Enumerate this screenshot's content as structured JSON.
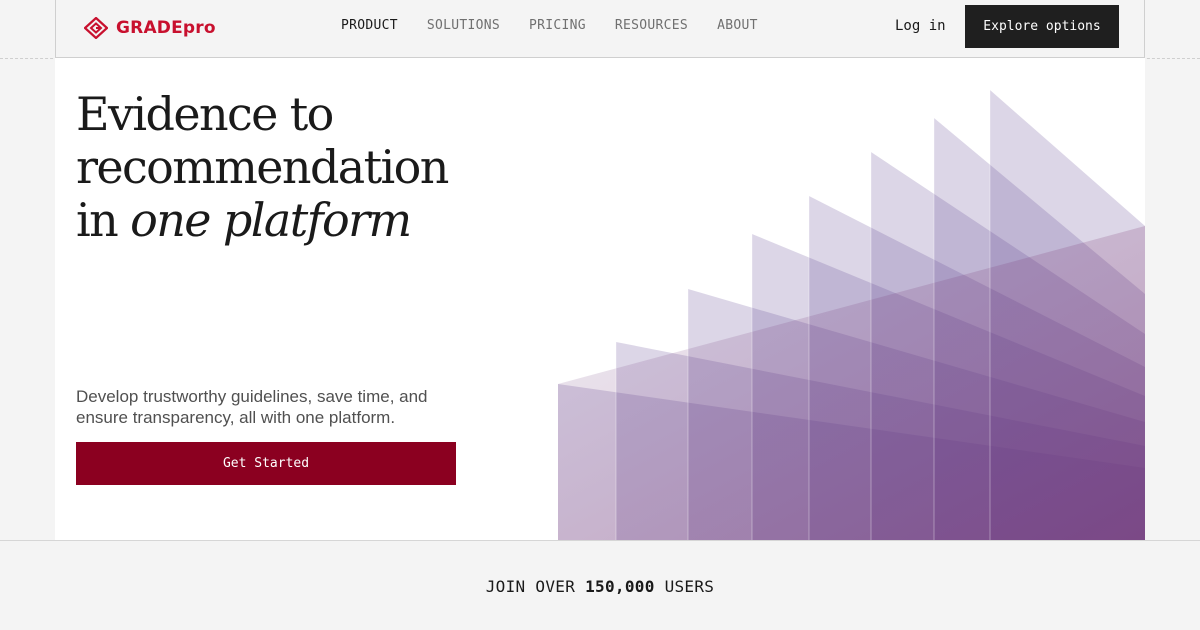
{
  "brand": {
    "name": "GRADEpro",
    "accent_color": "#c8102e",
    "logo_icon": "diamond-logo-icon"
  },
  "nav": {
    "items": [
      {
        "label": "PRODUCT",
        "active": true
      },
      {
        "label": "SOLUTIONS",
        "active": false
      },
      {
        "label": "PRICING",
        "active": false
      },
      {
        "label": "RESOURCES",
        "active": false
      },
      {
        "label": "ABOUT",
        "active": false
      }
    ],
    "login_label": "Log in",
    "explore_label": "Explore options"
  },
  "hero": {
    "headline_line1": "Evidence to",
    "headline_line2": "recommendation",
    "headline_line3_prefix": "in ",
    "headline_line3_emphasis": "one platform",
    "subtext": "Develop trustworthy guidelines, save time, and ensure transparency, all with one platform.",
    "cta_label": "Get Started",
    "cta_color": "#8b0020"
  },
  "footer": {
    "join_prefix": "JOIN OVER",
    "join_count": "150,000",
    "join_suffix": "USERS"
  }
}
